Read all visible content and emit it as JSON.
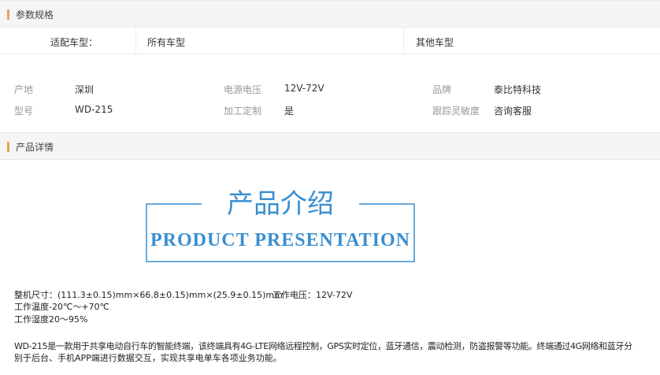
{
  "params_section": {
    "title": "参数规格"
  },
  "fitment": {
    "label": "适配车型：",
    "option1": "所有车型",
    "option2": "其他车型"
  },
  "specs": [
    {
      "label": "产地",
      "value": "深圳"
    },
    {
      "label": "电源电压",
      "value": "12V-72V"
    },
    {
      "label": "品牌",
      "value": "泰比特科技"
    },
    {
      "label": "型号",
      "value": "WD-215"
    },
    {
      "label": "加工定制",
      "value": "是"
    },
    {
      "label": "跟踪灵敏度",
      "value": "咨询客服"
    }
  ],
  "details_section": {
    "title": "产品详情"
  },
  "intro": {
    "title_cn": "产品介绍",
    "title_en": "PRODUCT PRESENTATION",
    "color": "#3a8fd0"
  },
  "description": {
    "size_line": "整机尺寸：(111.3±0.15)mm×66.8±0.15)mm×(25.9±0.15)mm",
    "voltage_line": "工作电压：12V-72V",
    "temp_line": "工作温度-20℃～+70℃",
    "humidity_line": "工作湿度20～95%",
    "para_line1": "WD-215是一款用于共享电动自行车的智能终端，该终端具有4G-LTE网络远程控制，GPS实时定位，蓝牙通信，震动检测，防盗报警等功能。终端通过4G网络和蓝牙分",
    "para_line2": "别于后台、手机APP端进行数据交互，实现共享电单车各项业务功能。"
  }
}
